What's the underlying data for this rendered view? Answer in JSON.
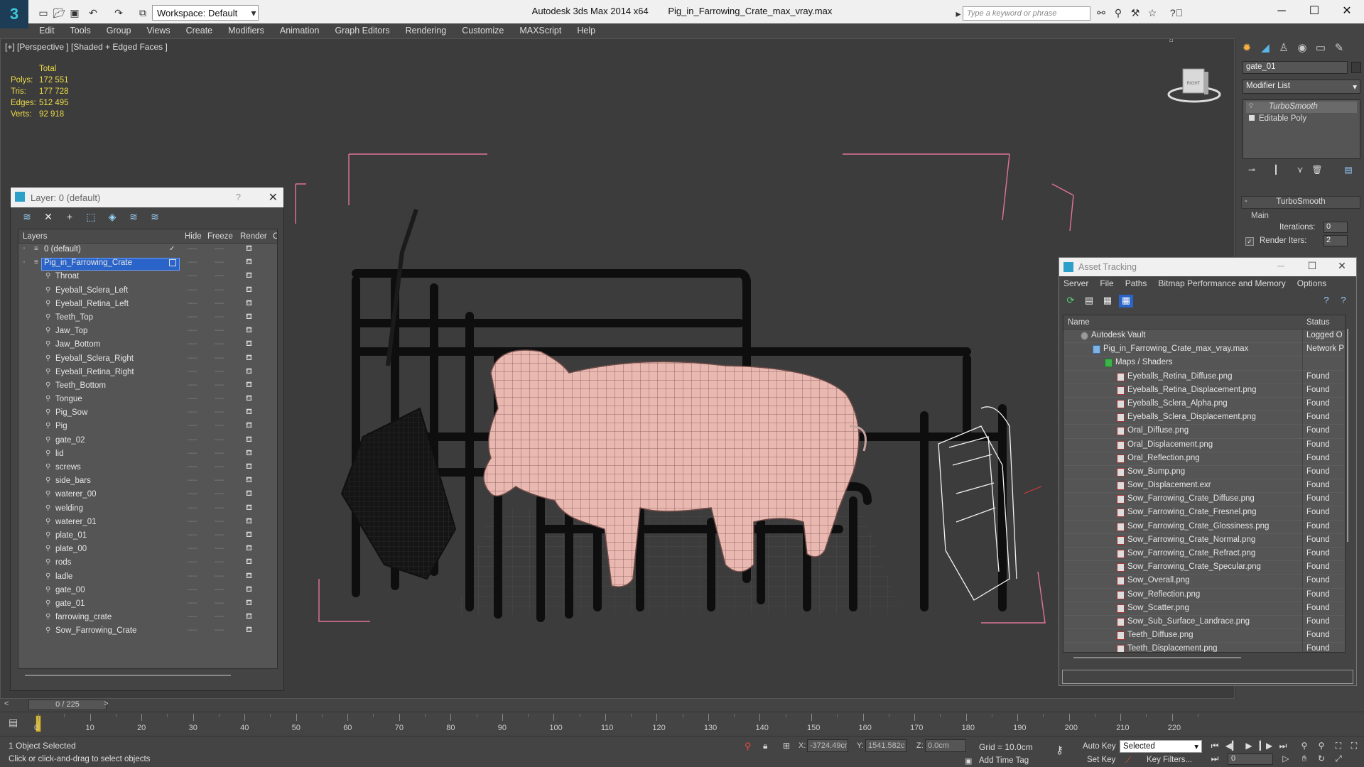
{
  "app": {
    "title": "Autodesk 3ds Max  2014 x64",
    "file": "Pig_in_Farrowing_Crate_max_vray.max",
    "workspace": "Workspace: Default",
    "search_placeholder": "Type a keyword or phrase"
  },
  "menu": [
    "Edit",
    "Tools",
    "Group",
    "Views",
    "Create",
    "Modifiers",
    "Animation",
    "Graph Editors",
    "Rendering",
    "Customize",
    "MAXScript",
    "Help"
  ],
  "viewport": {
    "label": "[+] [Perspective ] [Shaded + Edged Faces ]",
    "stats_header": "Total",
    "stats": [
      {
        "k": "Polys:",
        "v": "172 551"
      },
      {
        "k": "Tris:",
        "v": "177 728"
      },
      {
        "k": "Edges:",
        "v": "512 495"
      },
      {
        "k": "Verts:",
        "v": "92 918"
      }
    ],
    "viewcube_label": "RIGHT"
  },
  "layers": {
    "title": "Layer: 0 (default)",
    "help": "?",
    "col_layers": "Layers",
    "col_hide": "Hide",
    "col_freeze": "Freeze",
    "col_render": "Render",
    "col_extra": "C",
    "rows": [
      {
        "name": "0 (default)",
        "level": 0,
        "check": "✓"
      },
      {
        "name": "Pig_in_Farrowing_Crate",
        "level": 0,
        "selected": true
      },
      {
        "name": "Throat",
        "level": 1
      },
      {
        "name": "Eyeball_Sclera_Left",
        "level": 1
      },
      {
        "name": "Eyeball_Retina_Left",
        "level": 1
      },
      {
        "name": "Teeth_Top",
        "level": 1
      },
      {
        "name": "Jaw_Top",
        "level": 1
      },
      {
        "name": "Jaw_Bottom",
        "level": 1
      },
      {
        "name": "Eyeball_Sclera_Right",
        "level": 1
      },
      {
        "name": "Eyeball_Retina_Right",
        "level": 1
      },
      {
        "name": "Teeth_Bottom",
        "level": 1
      },
      {
        "name": "Tongue",
        "level": 1
      },
      {
        "name": "Pig_Sow",
        "level": 1
      },
      {
        "name": "Pig",
        "level": 1
      },
      {
        "name": "gate_02",
        "level": 1
      },
      {
        "name": "lid",
        "level": 1
      },
      {
        "name": "screws",
        "level": 1
      },
      {
        "name": "side_bars",
        "level": 1
      },
      {
        "name": "waterer_00",
        "level": 1
      },
      {
        "name": "welding",
        "level": 1
      },
      {
        "name": "waterer_01",
        "level": 1
      },
      {
        "name": "plate_01",
        "level": 1
      },
      {
        "name": "plate_00",
        "level": 1
      },
      {
        "name": "rods",
        "level": 1
      },
      {
        "name": "ladle",
        "level": 1
      },
      {
        "name": "gate_00",
        "level": 1
      },
      {
        "name": "gate_01",
        "level": 1
      },
      {
        "name": "farrowing_crate",
        "level": 1
      },
      {
        "name": "Sow_Farrowing_Crate",
        "level": 1
      }
    ]
  },
  "command_panel": {
    "object_name": "gate_01",
    "modifier_list": "Modifier List",
    "stack": [
      "TurboSmooth",
      "Editable Poly"
    ],
    "rollout": "TurboSmooth",
    "group": "Main",
    "iterations_label": "Iterations:",
    "iterations": "0",
    "render_iters_label": "Render Iters:",
    "render_iters": "2"
  },
  "asset_tracking": {
    "title": "Asset Tracking",
    "menu": [
      "Server",
      "File",
      "Paths",
      "Bitmap Performance and Memory",
      "Options"
    ],
    "col_name": "Name",
    "col_status": "Status",
    "rows": [
      {
        "name": "Autodesk Vault",
        "status": "Logged O",
        "level": 0
      },
      {
        "name": "Pig_in_Farrowing_Crate_max_vray.max",
        "status": "Network P",
        "level": 1
      },
      {
        "name": "Maps / Shaders",
        "status": "",
        "level": 2
      },
      {
        "name": "Eyeballs_Retina_Diffuse.png",
        "status": "Found",
        "level": 3
      },
      {
        "name": "Eyeballs_Retina_Displacement.png",
        "status": "Found",
        "level": 3
      },
      {
        "name": "Eyeballs_Sclera_Alpha.png",
        "status": "Found",
        "level": 3
      },
      {
        "name": "Eyeballs_Sclera_Displacement.png",
        "status": "Found",
        "level": 3
      },
      {
        "name": "Oral_Diffuse.png",
        "status": "Found",
        "level": 3
      },
      {
        "name": "Oral_Displacement.png",
        "status": "Found",
        "level": 3
      },
      {
        "name": "Oral_Reflection.png",
        "status": "Found",
        "level": 3
      },
      {
        "name": "Sow_Bump.png",
        "status": "Found",
        "level": 3
      },
      {
        "name": "Sow_Displacement.exr",
        "status": "Found",
        "level": 3
      },
      {
        "name": "Sow_Farrowing_Crate_Diffuse.png",
        "status": "Found",
        "level": 3
      },
      {
        "name": "Sow_Farrowing_Crate_Fresnel.png",
        "status": "Found",
        "level": 3
      },
      {
        "name": "Sow_Farrowing_Crate_Glossiness.png",
        "status": "Found",
        "level": 3
      },
      {
        "name": "Sow_Farrowing_Crate_Normal.png",
        "status": "Found",
        "level": 3
      },
      {
        "name": "Sow_Farrowing_Crate_Refract.png",
        "status": "Found",
        "level": 3
      },
      {
        "name": "Sow_Farrowing_Crate_Specular.png",
        "status": "Found",
        "level": 3
      },
      {
        "name": "Sow_Overall.png",
        "status": "Found",
        "level": 3
      },
      {
        "name": "Sow_Reflection.png",
        "status": "Found",
        "level": 3
      },
      {
        "name": "Sow_Scatter.png",
        "status": "Found",
        "level": 3
      },
      {
        "name": "Sow_Sub_Surface_Landrace.png",
        "status": "Found",
        "level": 3
      },
      {
        "name": "Teeth_Diffuse.png",
        "status": "Found",
        "level": 3
      },
      {
        "name": "Teeth_Displacement.png",
        "status": "Found",
        "level": 3
      }
    ]
  },
  "timeline": {
    "frame": "0 / 225",
    "ticks": [
      "0",
      "10",
      "20",
      "30",
      "40",
      "50",
      "60",
      "70",
      "80",
      "90",
      "100",
      "110",
      "120",
      "130",
      "140",
      "150",
      "160",
      "170",
      "180",
      "190",
      "200",
      "210",
      "220"
    ]
  },
  "status": {
    "selected": "1 Object Selected",
    "prompt": "Click or click-and-drag to select objects",
    "x_label": "X:",
    "x": "-3724.49cr",
    "y_label": "Y:",
    "y": "1541.582c",
    "z_label": "Z:",
    "z": "0.0cm",
    "grid": "Grid = 10.0cm",
    "add_time_tag": "Add Time Tag",
    "auto_key": "Auto Key",
    "set_key": "Set Key",
    "selected_dd": "Selected",
    "key_filters": "Key Filters...",
    "current_frame": "0"
  },
  "colors": {
    "selection": "#2b64c8",
    "stats": "#ecdc48",
    "bbox": "#e0749a",
    "time_cursor": "#d6b83a"
  }
}
